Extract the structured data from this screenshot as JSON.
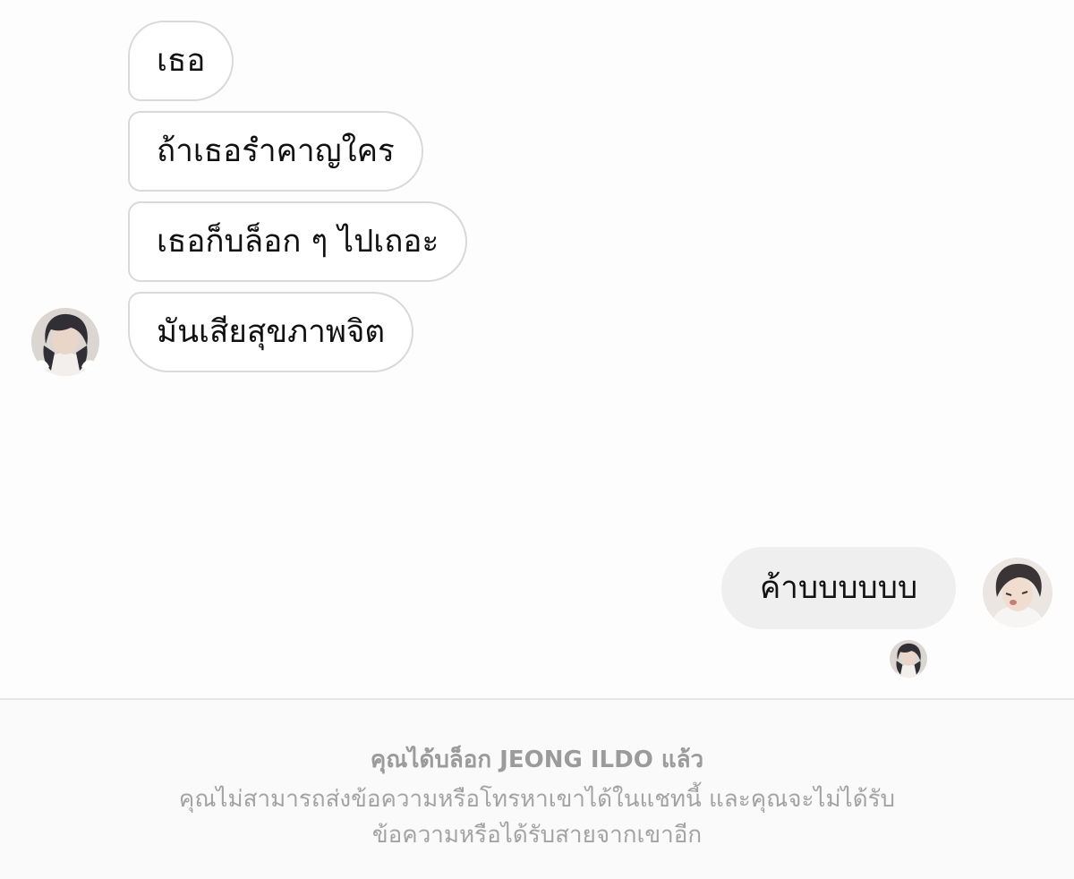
{
  "conversation": {
    "contact_name": "JEONG ILDO",
    "incoming_messages": [
      "เธอ",
      "ถ้าเธอรำคาญใคร",
      "เธอก็บล็อก ๆ ไปเถอะ",
      "มันเสียสุขภาพจิต"
    ],
    "outgoing_messages": [
      "ค้าบบบบบบ"
    ]
  },
  "blocked_notice": {
    "title": "คุณได้บล็อก JEONG ILDO แล้ว",
    "description_line1": "คุณไม่สามารถส่งข้อความหรือโทรหาเขาได้ในแชทนี้ และคุณจะไม่ได้รับ",
    "description_line2": "ข้อความหรือได้รับสายจากเขาอีก"
  },
  "icons": {
    "contact_avatar": "contact-avatar-icon",
    "user_avatar": "user-avatar-icon",
    "seen_avatar": "seen-receipt-avatar-icon"
  }
}
